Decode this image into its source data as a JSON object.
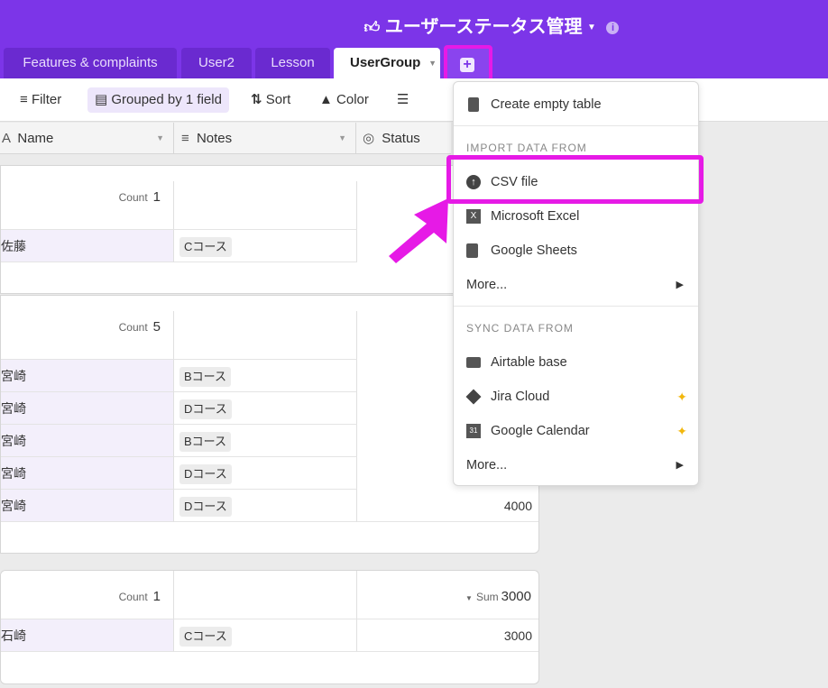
{
  "header": {
    "title": "ユーザーステータス管理",
    "tabs": [
      {
        "label": "Features & complaints"
      },
      {
        "label": "User2"
      },
      {
        "label": "Lesson"
      },
      {
        "label": "UserGroup"
      }
    ]
  },
  "toolbar": {
    "filter": "Filter",
    "grouped": "Grouped by 1 field",
    "sort": "Sort",
    "color": "Color"
  },
  "columns": {
    "name": "Name",
    "notes": "Notes",
    "status": "Status"
  },
  "groups": [
    {
      "count_label": "Count",
      "count": "1",
      "rows": [
        {
          "name": "佐藤",
          "note": "Cコース",
          "value": ""
        }
      ]
    },
    {
      "count_label": "Count",
      "count": "5",
      "rows": [
        {
          "name": "宮崎",
          "note": "Bコース",
          "value": ""
        },
        {
          "name": "宮崎",
          "note": "Dコース",
          "value": ""
        },
        {
          "name": "宮崎",
          "note": "Bコース",
          "value": ""
        },
        {
          "name": "宮崎",
          "note": "Dコース",
          "value": ""
        },
        {
          "name": "宮崎",
          "note": "Dコース",
          "value": "4000"
        }
      ]
    },
    {
      "count_label": "Count",
      "count": "1",
      "sum_label": "Sum",
      "sum": "3000",
      "rows": [
        {
          "name": "石崎",
          "note": "Cコース",
          "value": "3000"
        }
      ]
    }
  ],
  "menu": {
    "create_empty": "Create empty table",
    "import_header": "IMPORT DATA FROM",
    "import_items": [
      {
        "label": "CSV file"
      },
      {
        "label": "Microsoft Excel"
      },
      {
        "label": "Google Sheets"
      },
      {
        "label": "More..."
      }
    ],
    "sync_header": "SYNC DATA FROM",
    "sync_items": [
      {
        "label": "Airtable base"
      },
      {
        "label": "Jira Cloud"
      },
      {
        "label": "Google Calendar"
      },
      {
        "label": "More..."
      }
    ]
  },
  "colors": {
    "brand": "#7c35e8",
    "highlight": "#e61ae6"
  }
}
